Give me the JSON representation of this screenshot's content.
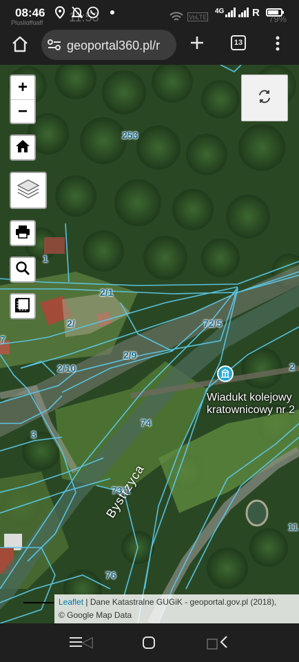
{
  "status": {
    "time": "08:46",
    "ghost_time": "11:53",
    "ghost_carrier": "Plusligffgaff",
    "ghost_battery": "79%",
    "volte": "VoLTE",
    "network": "4G",
    "roaming": "R",
    "icons": [
      "location-icon",
      "mute-icon",
      "whatsapp-icon",
      "notification-dot-icon",
      "wifi-icon",
      "signal-icon",
      "battery-icon"
    ]
  },
  "browser": {
    "url": "geoportal360.pl/r",
    "tab_count": "13",
    "icons": [
      "home-icon",
      "site-settings-icon",
      "new-tab-icon",
      "menu-icon"
    ]
  },
  "map": {
    "parcels": [
      "253",
      "1",
      "2/1",
      "2/",
      "7",
      "2/10",
      "2/9",
      "72/5",
      "74",
      "3",
      "73/1",
      "76",
      "11",
      "2"
    ],
    "street": "Bystrzyca",
    "poi_line1": "Wiadukt kolejowy",
    "poi_line2": "kratownicowy nr 2",
    "controls": {
      "zoom_in": "+",
      "zoom_out": "−",
      "icons": [
        "home-icon",
        "layers-icon",
        "print-icon",
        "search-icon",
        "measure-icon",
        "refresh-icon"
      ]
    },
    "attribution_link": "Leaflet",
    "attribution_text": " | Dane Katastralne GUGiK - geoportal.gov.pl (2018),",
    "attribution_text2": "© Google Map Data",
    "parcel_line_color": "#5ac8e8",
    "label_color": "#1c6d94"
  },
  "nav": {
    "icons": [
      "recents-icon",
      "home-circle-icon",
      "back-icon"
    ]
  }
}
